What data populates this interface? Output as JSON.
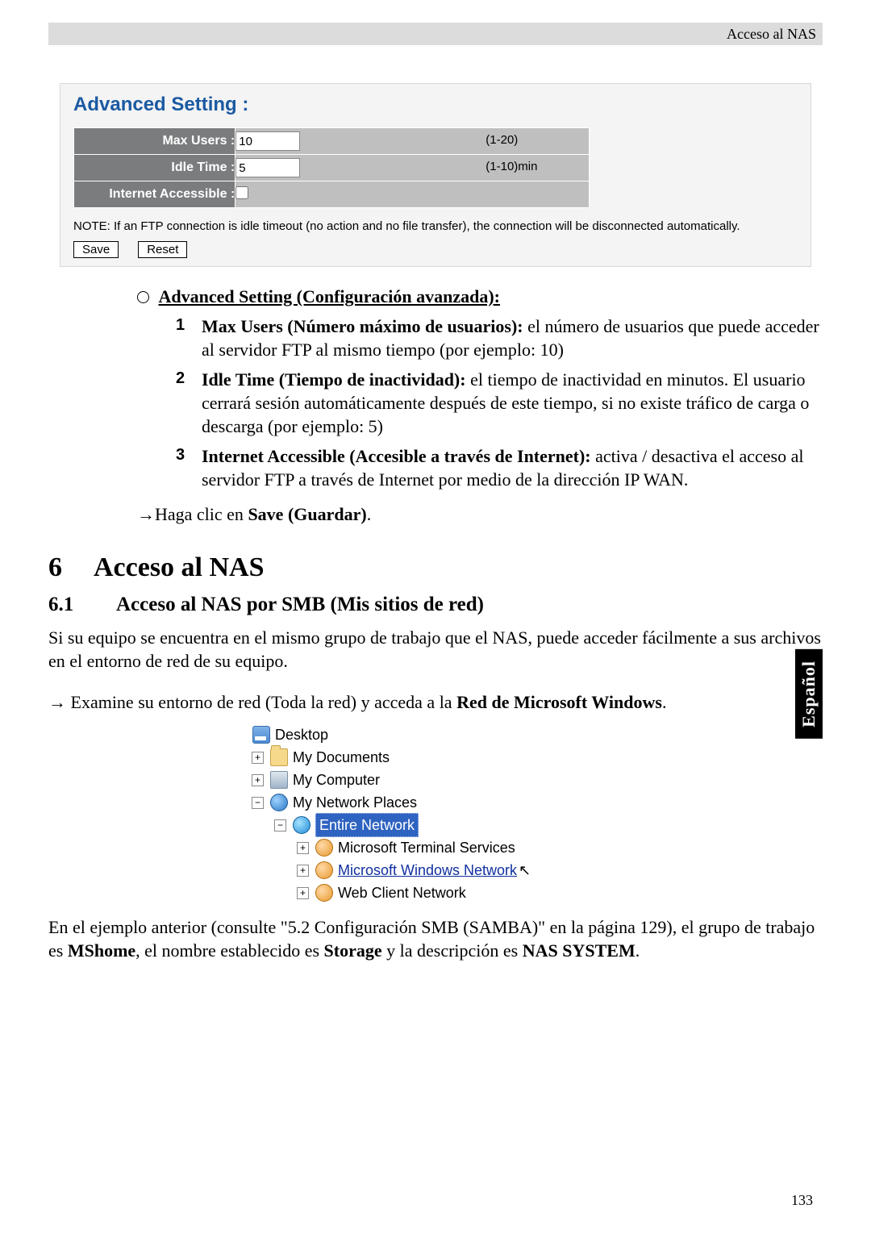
{
  "header": {
    "right": "Acceso al NAS"
  },
  "panel": {
    "title": "Advanced Setting  :",
    "rows": {
      "maxusers": {
        "label": "Max Users :",
        "value": "10",
        "hint": "(1-20)"
      },
      "idletime": {
        "label": "Idle Time :",
        "value": "5",
        "hint": "(1-10)min"
      },
      "internet": {
        "label": "Internet Accessible :"
      }
    },
    "note": "NOTE: If an FTP connection is idle timeout (no action and no file transfer), the connection will be disconnected automatically.",
    "buttons": {
      "save": "Save",
      "reset": "Reset"
    }
  },
  "adv": {
    "heading": "Advanced Setting (Configuración avanzada):",
    "items": [
      {
        "n": "1",
        "bold": "Max Users (Número máximo de usuarios):",
        "rest": " el número de usuarios que puede acceder al servidor FTP al mismo tiempo (por ejemplo: 10)"
      },
      {
        "n": "2",
        "bold": "Idle Time (Tiempo de inactividad):",
        "rest": " el tiempo de inactividad en minutos. El usuario cerrará sesión automáticamente después de este tiempo, si no existe tráfico de carga o descarga (por ejemplo: 5)"
      },
      {
        "n": "3",
        "bold": "Internet Accessible (Accesible a través de Internet):",
        "rest": " activa / desactiva el acceso al servidor FTP a través de Internet por medio de la dirección IP WAN."
      }
    ],
    "saveline_pre": "Haga clic en ",
    "saveline_bold": "Save (Guardar)",
    "saveline_post": "."
  },
  "chapter": {
    "num": "6",
    "title": "Acceso al NAS"
  },
  "section": {
    "num": "6.1",
    "title": "Acceso al NAS por SMB (Mis sitios de red)"
  },
  "para61": "Si su equipo se encuentra en el mismo grupo de trabajo que el NAS, puede acceder fácilmente a sus archivos en el entorno de red de su equipo.",
  "step": {
    "pre": " Examine su entorno de red (Toda la red) y acceda a la ",
    "bold": "Red de Microsoft Windows",
    "post": "."
  },
  "tree": {
    "desktop": "Desktop",
    "mydocs": "My Documents",
    "mycomp": "My Computer",
    "netplaces": "My Network Places",
    "entire": "Entire Network",
    "mts": "Microsoft Terminal Services",
    "mwn": "Microsoft Windows Network",
    "wcn": "Web Client Network"
  },
  "afterTree": {
    "t1": "En el ejemplo anterior (consulte \"5.2 Configuración SMB (SAMBA)\" en la página 129), el grupo de trabajo es ",
    "b1": "MShome",
    "t2": ", el nombre establecido es ",
    "b2": "Storage",
    "t3": " y la descripción es ",
    "b3": "NAS SYSTEM",
    "t4": "."
  },
  "langtab": "Español",
  "pageno": "133"
}
